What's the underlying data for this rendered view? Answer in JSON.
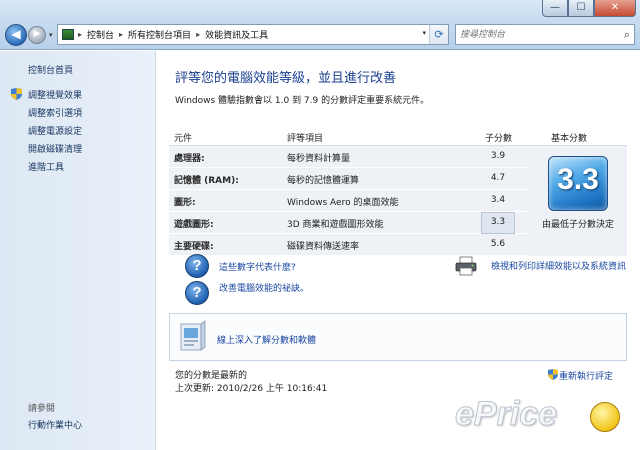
{
  "window": {
    "min_label": "—",
    "max_label": "☐",
    "close_label": "✕"
  },
  "nav": {
    "back_glyph": "◀",
    "forward_glyph": "▶"
  },
  "breadcrumb": [
    "控制台",
    "所有控制台項目",
    "效能資訊及工具"
  ],
  "search": {
    "placeholder": "搜尋控制台"
  },
  "sidebar": {
    "home": "控制台首頁",
    "items": [
      {
        "label": "調整視覺效果",
        "icon": "shield-icon"
      },
      {
        "label": "調整索引選項"
      },
      {
        "label": "調整電源設定"
      },
      {
        "label": "開啟磁碟清理"
      },
      {
        "label": "進階工具"
      }
    ],
    "see_also": "請參閱",
    "see_also_items": [
      "行動作業中心"
    ]
  },
  "main": {
    "heading": "評等您的電腦效能等級，並且進行改善",
    "subtext": "Windows 體驗指數會以 1.0 到 7.9 的分數評定重要系統元件。",
    "table": {
      "headers": {
        "component": "元件",
        "item": "評等項目",
        "subscore": "子分數",
        "basescore": "基本分數"
      },
      "rows": [
        {
          "component": "處理器:",
          "item": "每秒資料計算量",
          "score": "3.9"
        },
        {
          "component": "記憶體 (RAM):",
          "item": "每秒的記憶體運算",
          "score": "4.7"
        },
        {
          "component": "圖形:",
          "item": "Windows Aero 的桌面效能",
          "score": "3.4"
        },
        {
          "component": "遊戲圖形:",
          "item": "3D 商業和遊戲圖形效能",
          "score": "3.3"
        },
        {
          "component": "主要硬碟:",
          "item": "磁碟資料傳送速率",
          "score": "5.6"
        }
      ],
      "base_score": "3.3",
      "base_caption": "由最低子分數決定"
    },
    "links": {
      "what_mean": "這些數字代表什麼?",
      "tips": "改善電腦效能的祕訣。",
      "print": "檢視和列印詳細效能以及系統資訊",
      "learn": "線上深入了解分數和軟體"
    },
    "status": {
      "current": "您的分數是最新的",
      "last_update": "上次更新: 2010/2/26 上午 10:16:41"
    },
    "rerun": "重新執行評定"
  },
  "watermark": "ePrice"
}
